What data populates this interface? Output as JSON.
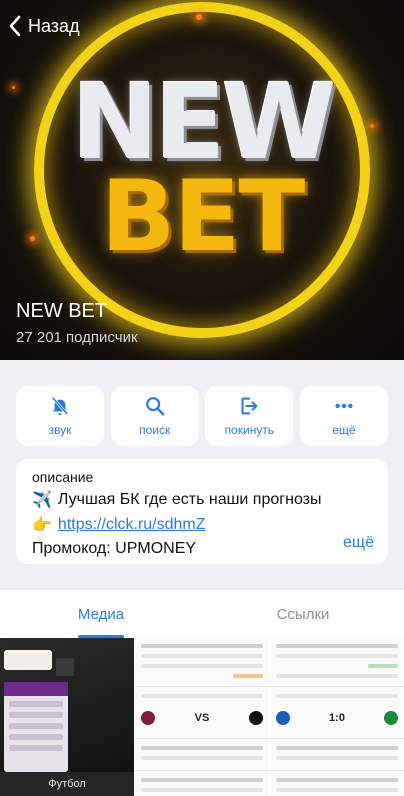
{
  "nav": {
    "back_label": "Назад"
  },
  "channel": {
    "name": "NEW BET",
    "subscribers": "27 201 подписчик"
  },
  "cover_logo": {
    "line1": "NEW",
    "line2": "BET"
  },
  "actions": [
    {
      "label": "звук",
      "icon": "bell-mute-icon"
    },
    {
      "label": "поиск",
      "icon": "search-icon"
    },
    {
      "label": "покинуть",
      "icon": "leave-icon"
    },
    {
      "label": "ещё",
      "icon": "more-icon"
    }
  ],
  "description": {
    "title": "описание",
    "line1_emoji": "✈️",
    "line1_text": "Лучшая БК где есть наши прогнозы",
    "line2_emoji": "👉",
    "line2_link": "https://clck.ru/sdhmZ",
    "line3_text": "Промокод: UPMONEY",
    "more_label": "ещё"
  },
  "tabs": [
    {
      "label": "Медиа",
      "active": true
    },
    {
      "label": "Ссылки",
      "active": false
    }
  ],
  "media": {
    "first_caption": "Футбол"
  },
  "colors": {
    "accent": "#2d7bd9",
    "gold": "#f3d21a"
  }
}
